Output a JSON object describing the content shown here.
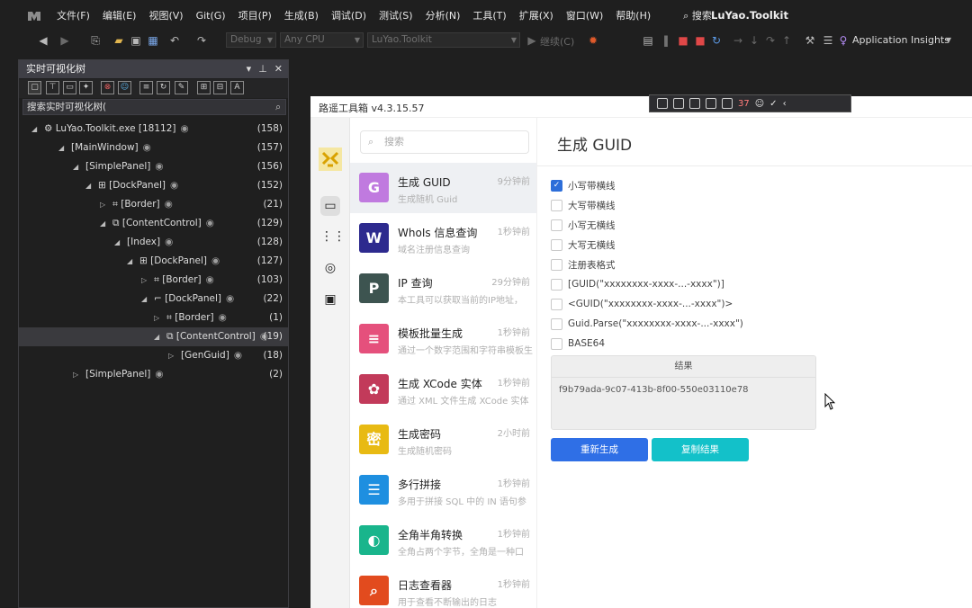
{
  "app": {
    "menu": [
      "文件(F)",
      "编辑(E)",
      "视图(V)",
      "Git(G)",
      "项目(P)",
      "生成(B)",
      "调试(D)",
      "测试(S)",
      "分析(N)",
      "工具(T)",
      "扩展(X)",
      "窗口(W)",
      "帮助(H)"
    ],
    "search_label": "搜索",
    "solution_title": "LuYao.Toolkit"
  },
  "toolbar": {
    "config": "Debug",
    "platform": "Any CPU",
    "startup": "LuYao.Toolkit",
    "continue_label": "继续(C)",
    "insights_label": "Application Insights"
  },
  "live_tree": {
    "title": "实时可视化树",
    "search_placeholder": "搜索实时可视化树(",
    "rows": [
      {
        "label": "LuYao.Toolkit.exe [18112]",
        "count": "(158)"
      },
      {
        "label": "[MainWindow]",
        "count": "(157)"
      },
      {
        "label": "[SimplePanel]",
        "count": "(156)"
      },
      {
        "label": "[DockPanel]",
        "count": "(152)"
      },
      {
        "label": "[Border]",
        "count": "(21)"
      },
      {
        "label": "[ContentControl]",
        "count": "(129)"
      },
      {
        "label": "[Index]",
        "count": "(128)"
      },
      {
        "label": "[DockPanel]",
        "count": "(127)"
      },
      {
        "label": "[Border]",
        "count": "(103)"
      },
      {
        "label": "[DockPanel]",
        "count": "(22)"
      },
      {
        "label": "[Border]",
        "count": "(1)"
      },
      {
        "label": "[ContentControl]",
        "count": "(19)"
      },
      {
        "label": "[GenGuid]",
        "count": "(18)"
      },
      {
        "label": "[SimplePanel]",
        "count": "(2)"
      }
    ]
  },
  "toolkit": {
    "window_title": "路遥工具箱 v4.3.15.57",
    "debug_counter": "37",
    "search_placeholder": "搜索",
    "tools": [
      {
        "name": "生成 GUID",
        "desc": "生成随机 Guid",
        "time": "9分钟前",
        "color": "#c07adf",
        "icon": "G"
      },
      {
        "name": "WhoIs 信息查询",
        "desc": "域名注册信息查询",
        "time": "1秒钟前",
        "color": "#2d2a8e",
        "icon": "W"
      },
      {
        "name": "IP 查询",
        "desc": "本工具可以获取当前的IP地址，",
        "time": "29分钟前",
        "color": "#3d5450",
        "icon": "P"
      },
      {
        "name": "模板批量生成",
        "desc": "通过一个数字范围和字符串模板生",
        "time": "1秒钟前",
        "color": "#e5507c",
        "icon": "≡"
      },
      {
        "name": "生成 XCode 实体",
        "desc": "通过 XML 文件生成 XCode 实体",
        "time": "1秒钟前",
        "color": "#c23a5a",
        "icon": "✿"
      },
      {
        "name": "生成密码",
        "desc": "生成随机密码",
        "time": "2小时前",
        "color": "#e8ba13",
        "icon": "密"
      },
      {
        "name": "多行拼接",
        "desc": "多用于拼接 SQL 中的 IN 语句参",
        "time": "1秒钟前",
        "color": "#1e8fe0",
        "icon": "☰"
      },
      {
        "name": "全角半角转换",
        "desc": "全角占两个字节，全角是一种口",
        "time": "1秒钟前",
        "color": "#19b58c",
        "icon": "◐"
      },
      {
        "name": "日志查看器",
        "desc": "用于查看不断输出的日志",
        "time": "1秒钟前",
        "color": "#e24b1e",
        "icon": "⌕"
      }
    ],
    "main_title": "生成 GUID",
    "options": [
      {
        "label": "小写带横线",
        "checked": true
      },
      {
        "label": "大写带横线",
        "checked": false
      },
      {
        "label": "小写无横线",
        "checked": false
      },
      {
        "label": "大写无横线",
        "checked": false
      },
      {
        "label": "注册表格式",
        "checked": false
      },
      {
        "label": "[GUID(\"xxxxxxxx-xxxx-...-xxxx\")]",
        "checked": false
      },
      {
        "label": "<GUID(\"xxxxxxxx-xxxx-...-xxxx\")>",
        "checked": false
      },
      {
        "label": "Guid.Parse(\"xxxxxxxx-xxxx-...-xxxx\")",
        "checked": false
      },
      {
        "label": "BASE64",
        "checked": false
      }
    ],
    "result_header": "结果",
    "result_value": "f9b79ada-9c07-413b-8f00-550e03110e78",
    "regen_label": "重新生成",
    "copy_label": "复制结果",
    "regen_color": "#2f6fe6",
    "copy_color": "#13c1c9"
  }
}
